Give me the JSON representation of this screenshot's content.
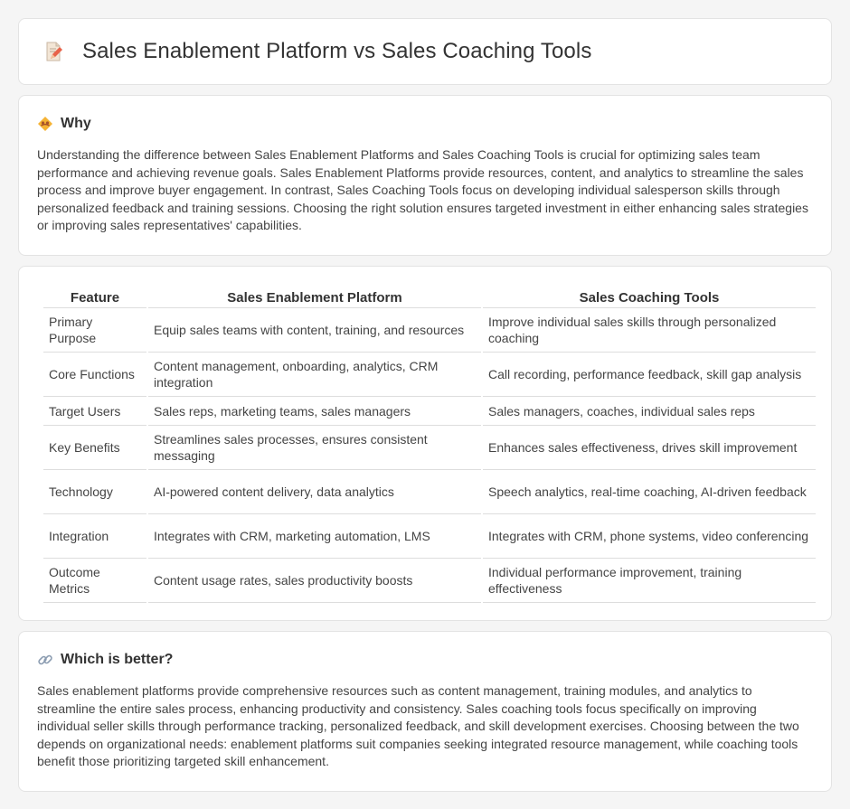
{
  "page": {
    "title": "Sales Enablement Platform vs Sales Coaching Tools",
    "title_icon": "document-edit-icon"
  },
  "why": {
    "heading": "Why",
    "icon": "handshake-icon",
    "text": "Understanding the difference between Sales Enablement Platforms and Sales Coaching Tools is crucial for optimizing sales team performance and achieving revenue goals. Sales Enablement Platforms provide resources, content, and analytics to streamline the sales process and improve buyer engagement. In contrast, Sales Coaching Tools focus on developing individual salesperson skills through personalized feedback and training sessions. Choosing the right solution ensures targeted investment in either enhancing sales strategies or improving sales representatives' capabilities."
  },
  "table": {
    "headers": [
      "Feature",
      "Sales Enablement Platform",
      "Sales Coaching Tools"
    ],
    "rows": [
      [
        "Primary Purpose",
        "Equip sales teams with content, training, and resources",
        "Improve individual sales skills through personalized coaching"
      ],
      [
        "Core Functions",
        "Content management, onboarding, analytics, CRM integration",
        "Call recording, performance feedback, skill gap analysis"
      ],
      [
        "Target Users",
        "Sales reps, marketing teams, sales managers",
        "Sales managers, coaches, individual sales reps"
      ],
      [
        "Key Benefits",
        "Streamlines sales processes, ensures consistent messaging",
        "Enhances sales effectiveness, drives skill improvement"
      ],
      [
        "Technology",
        "AI-powered content delivery, data analytics",
        "Speech analytics, real-time coaching, AI-driven feedback"
      ],
      [
        "Integration",
        "Integrates with CRM, marketing automation, LMS",
        "Integrates with CRM, phone systems, video conferencing"
      ],
      [
        "Outcome Metrics",
        "Content usage rates, sales productivity boosts",
        "Individual performance improvement, training effectiveness"
      ]
    ]
  },
  "better": {
    "heading": "Which is better?",
    "icon": "link-icon",
    "text": "Sales enablement platforms provide comprehensive resources such as content management, training modules, and analytics to streamline the entire sales process, enhancing productivity and consistency. Sales coaching tools focus specifically on improving individual seller skills through performance tracking, personalized feedback, and skill development exercises. Choosing between the two depends on organizational needs: enablement platforms suit companies seeking integrated resource management, while coaching tools benefit those prioritizing targeted skill enhancement."
  }
}
